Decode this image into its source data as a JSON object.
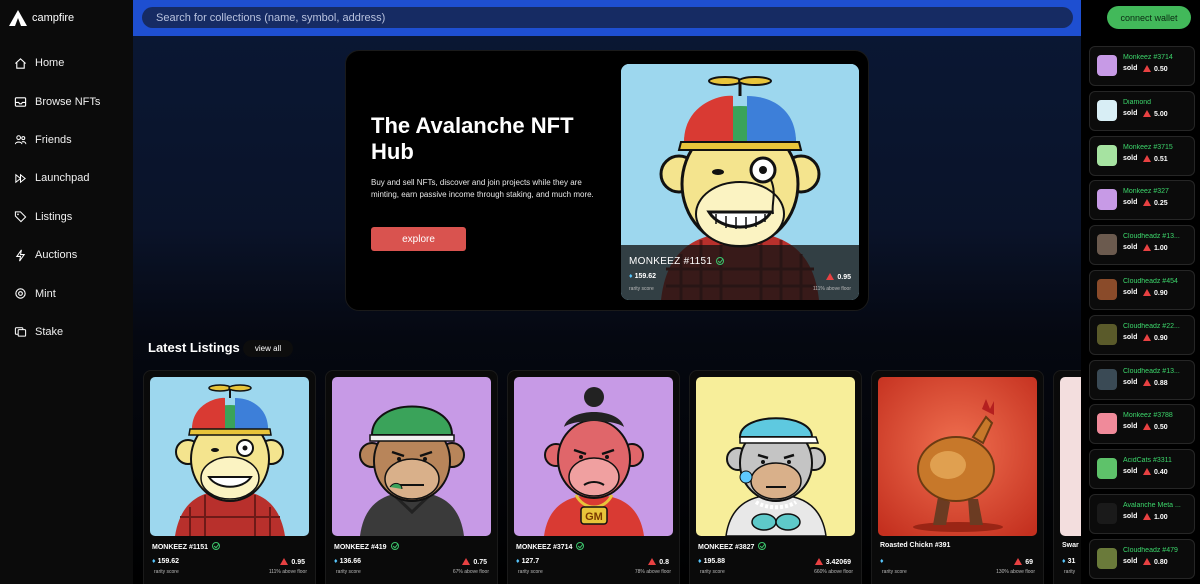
{
  "brand": {
    "name": "campfire",
    "logo_icon": "campfire-logo-icon"
  },
  "search": {
    "placeholder": "Search for collections (name, symbol, address)"
  },
  "nav": [
    {
      "label": "Home",
      "icon": "home-icon"
    },
    {
      "label": "Browse NFTs",
      "icon": "inbox-icon"
    },
    {
      "label": "Friends",
      "icon": "users-icon"
    },
    {
      "label": "Launchpad",
      "icon": "fast-forward-icon"
    },
    {
      "label": "Listings",
      "icon": "tag-icon"
    },
    {
      "label": "Auctions",
      "icon": "lightning-icon"
    },
    {
      "label": "Mint",
      "icon": "mint-icon"
    },
    {
      "label": "Stake",
      "icon": "stake-icon"
    }
  ],
  "hero": {
    "title": "The Avalanche NFT Hub",
    "description": "Buy and sell NFTs, discover and join projects while they are minting, earn passive income through staking, and much more.",
    "button": "explore",
    "featured": {
      "name": "MONKEEZ #1151",
      "rarity": "159.62",
      "rarity_label": "rarity score",
      "price": "0.95",
      "floor": "111% above floor"
    }
  },
  "listings": {
    "title": "Latest Listings",
    "view_all": "view all",
    "items": [
      {
        "name": "MONKEEZ #1151",
        "rarity": "159.62",
        "rarity_label": "rarity score",
        "price": "0.95",
        "floor": "111% above floor",
        "bg": "#9dd7ee"
      },
      {
        "name": "MONKEEZ #419",
        "rarity": "136.66",
        "rarity_label": "rarity score",
        "price": "0.75",
        "floor": "67% above floor",
        "bg": "#c79ae6"
      },
      {
        "name": "MONKEEZ #3714",
        "rarity": "127.7",
        "rarity_label": "rarity score",
        "price": "0.8",
        "floor": "78% above floor",
        "bg": "#c79ae6"
      },
      {
        "name": "MONKEEZ #3827",
        "rarity": "195.88",
        "rarity_label": "rarity score",
        "price": "3.42069",
        "floor": "660% above floor",
        "bg": "#f7ee9a"
      },
      {
        "name": "Roasted Chickn #391",
        "rarity": "",
        "rarity_label": "rarity score",
        "price": "69",
        "floor": "130% above floor",
        "bg": "#d9412c"
      },
      {
        "name": "Swar",
        "rarity": "31",
        "rarity_label": "rarity",
        "price": "",
        "floor": "",
        "bg": "#f3dede"
      }
    ]
  },
  "wallet": {
    "connect": "connect wallet"
  },
  "sales": [
    {
      "name": "Monkeez #3714",
      "status": "sold",
      "price": "0.50",
      "thumb": "#c79ae6"
    },
    {
      "name": "Diamond",
      "status": "sold",
      "price": "5.00",
      "thumb": "#d8eef5"
    },
    {
      "name": "Monkeez #3715",
      "status": "sold",
      "price": "0.51",
      "thumb": "#a6e3a1"
    },
    {
      "name": "Monkeez #327",
      "status": "sold",
      "price": "0.25",
      "thumb": "#c79ae6"
    },
    {
      "name": "Cloudheadz #13...",
      "status": "sold",
      "price": "1.00",
      "thumb": "#6b5a4e"
    },
    {
      "name": "Cloudheadz #454",
      "status": "sold",
      "price": "0.90",
      "thumb": "#8a4b2a"
    },
    {
      "name": "Cloudheadz #22...",
      "status": "sold",
      "price": "0.90",
      "thumb": "#5a5a2a"
    },
    {
      "name": "Cloudheadz #13...",
      "status": "sold",
      "price": "0.88",
      "thumb": "#3a4a55"
    },
    {
      "name": "Monkeez #3788",
      "status": "sold",
      "price": "0.50",
      "thumb": "#f08a9a"
    },
    {
      "name": "AcidCats #3311",
      "status": "sold",
      "price": "0.40",
      "thumb": "#5ec26a"
    },
    {
      "name": "Avalanche Meta ...",
      "status": "sold",
      "price": "1.00",
      "thumb": "#1a1a1a"
    },
    {
      "name": "Cloudheadz #479",
      "status": "sold",
      "price": "0.80",
      "thumb": "#6a7a3a"
    }
  ]
}
